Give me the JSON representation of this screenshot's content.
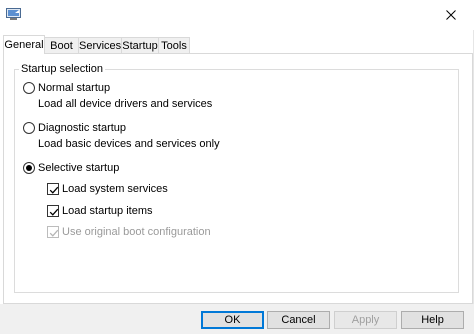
{
  "window": {
    "icon": "msconfig-icon",
    "close_icon": "close-icon"
  },
  "tabs": [
    {
      "label": "General",
      "active": true
    },
    {
      "label": "Boot",
      "active": false
    },
    {
      "label": "Services",
      "active": false
    },
    {
      "label": "Startup",
      "active": false
    },
    {
      "label": "Tools",
      "active": false
    }
  ],
  "startup_selection": {
    "group_title": "Startup selection",
    "normal": {
      "label": "Normal startup",
      "description": "Load all device drivers and services",
      "selected": false
    },
    "diagnostic": {
      "label": "Diagnostic startup",
      "description": "Load basic devices and services only",
      "selected": false
    },
    "selective": {
      "label": "Selective startup",
      "selected": true,
      "options": [
        {
          "label": "Load system services",
          "checked": true,
          "enabled": true
        },
        {
          "label": "Load startup items",
          "checked": true,
          "enabled": true
        },
        {
          "label": "Use original boot configuration",
          "checked": true,
          "enabled": false
        }
      ]
    }
  },
  "buttons": {
    "ok": "OK",
    "cancel": "Cancel",
    "apply": "Apply",
    "help": "Help"
  },
  "colors": {
    "accent": "#0078d7",
    "footer_bg": "#f0f0f0",
    "disabled_text": "#9a9a9a"
  }
}
